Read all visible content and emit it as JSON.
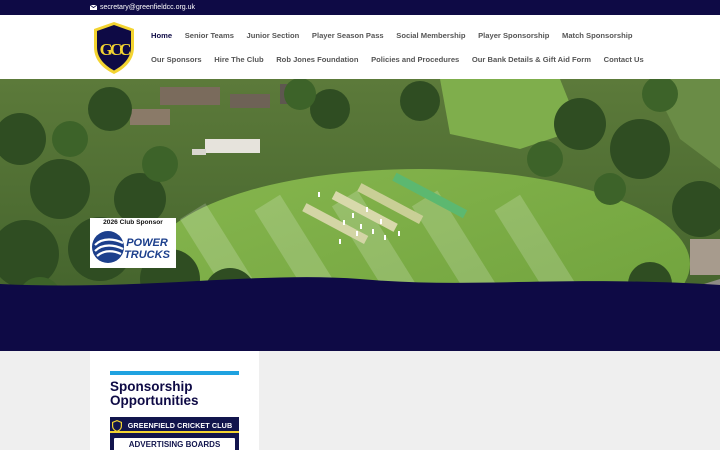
{
  "topbar": {
    "email": "secretary@greenfieldcc.org.uk",
    "icon": "envelope-icon"
  },
  "nav": {
    "row1": [
      "Home",
      "Senior Teams",
      "Junior Section",
      "Player Season Pass",
      "Social Membership",
      "Player Sponsorship",
      "Match Sponsorship"
    ],
    "row2": [
      "Our Sponsors",
      "Hire The Club",
      "Rob Jones Foundation",
      "Policies and Procedures",
      "Our Bank Details & Gift Aid Form",
      "Contact Us"
    ],
    "active": "Home"
  },
  "logo": {
    "letters": "GCC"
  },
  "sponsor": {
    "caption": "2026 Club Sponsor",
    "line1": "POWER",
    "line2": "TRUCKS"
  },
  "sidebar": {
    "title": "Sponsorship Opportunities",
    "banner_club": "GREENFIELD CRICKET CLUB",
    "banner_label": "ADVERTISING BOARDS"
  },
  "colors": {
    "navy": "#0e0a45",
    "accent": "#1fa2e0",
    "gold": "#f3d431"
  }
}
